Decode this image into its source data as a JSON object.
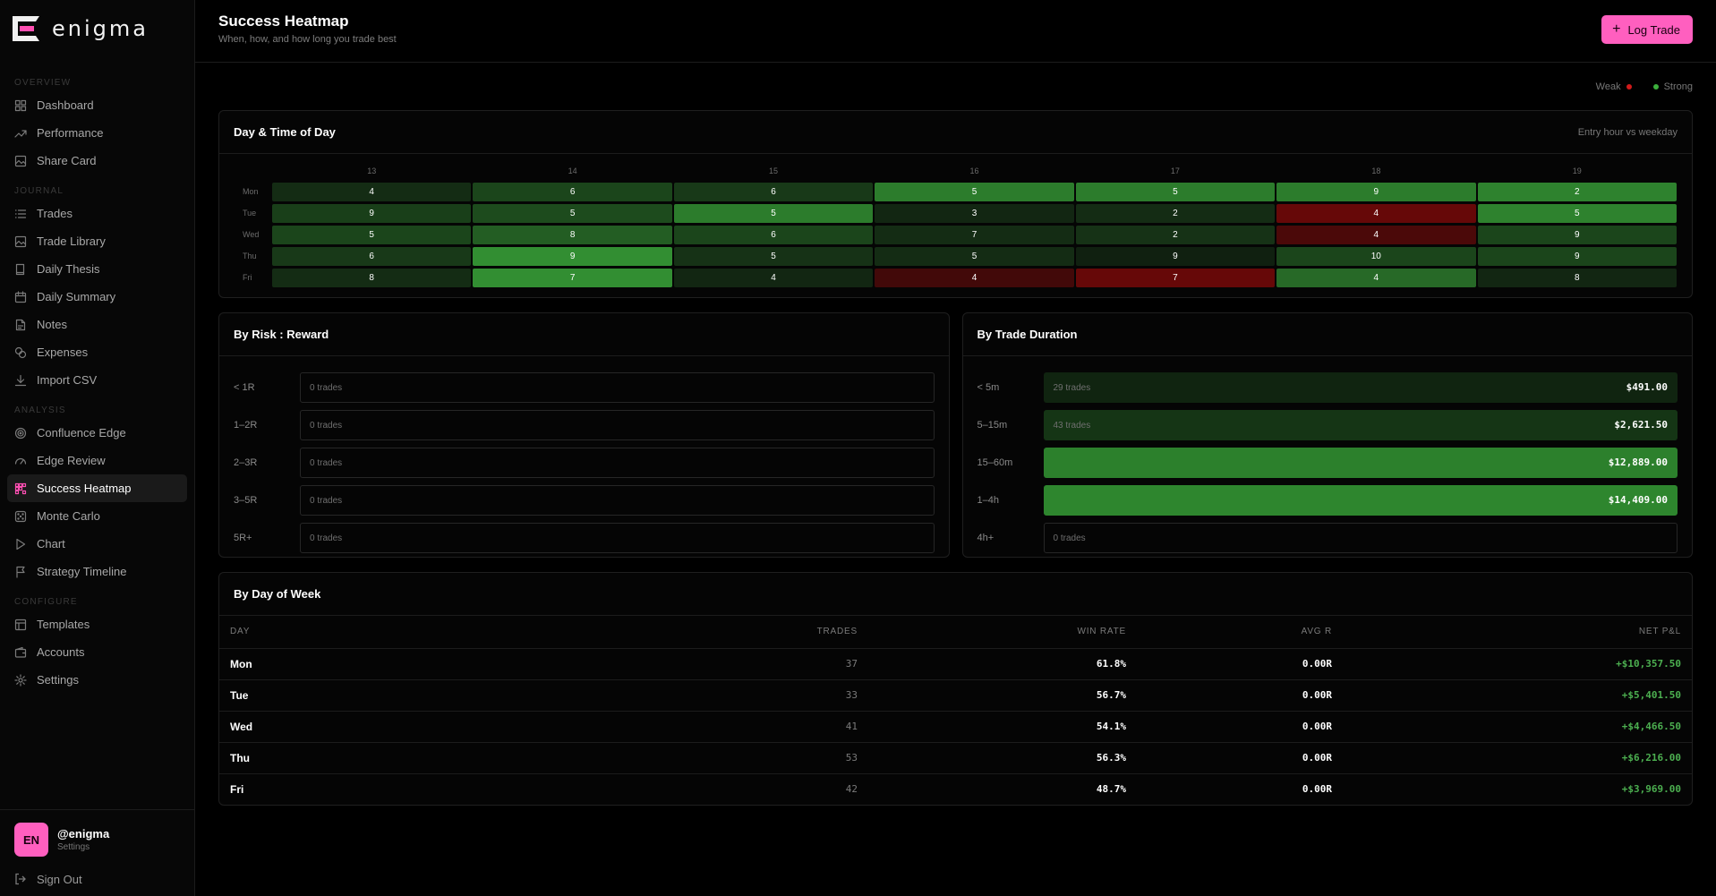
{
  "app": {
    "name": "enigma"
  },
  "sidebar": {
    "sections": [
      {
        "title": "OVERVIEW",
        "items": [
          {
            "label": "Dashboard",
            "icon": "grid-icon"
          },
          {
            "label": "Performance",
            "icon": "trend-up-icon"
          },
          {
            "label": "Share Card",
            "icon": "image-icon"
          }
        ]
      },
      {
        "title": "JOURNAL",
        "items": [
          {
            "label": "Trades",
            "icon": "list-icon"
          },
          {
            "label": "Trade Library",
            "icon": "image-icon"
          },
          {
            "label": "Daily Thesis",
            "icon": "book-icon"
          },
          {
            "label": "Daily Summary",
            "icon": "calendar-icon"
          },
          {
            "label": "Notes",
            "icon": "note-icon"
          },
          {
            "label": "Expenses",
            "icon": "coins-icon"
          },
          {
            "label": "Import CSV",
            "icon": "download-icon"
          }
        ]
      },
      {
        "title": "ANALYSIS",
        "items": [
          {
            "label": "Confluence Edge",
            "icon": "target-icon"
          },
          {
            "label": "Edge Review",
            "icon": "gauge-icon"
          },
          {
            "label": "Success Heatmap",
            "icon": "heatmap-icon",
            "active": true
          },
          {
            "label": "Monte Carlo",
            "icon": "dice-icon"
          },
          {
            "label": "Chart",
            "icon": "play-icon"
          },
          {
            "label": "Strategy Timeline",
            "icon": "flag-icon"
          }
        ]
      },
      {
        "title": "CONFIGURE",
        "items": [
          {
            "label": "Templates",
            "icon": "layout-icon"
          },
          {
            "label": "Accounts",
            "icon": "wallet-icon"
          },
          {
            "label": "Settings",
            "icon": "gear-icon"
          }
        ]
      }
    ]
  },
  "user": {
    "initials": "EN",
    "name": "@enigma",
    "sub": "Settings",
    "signout": "Sign Out"
  },
  "header": {
    "title": "Success Heatmap",
    "subtitle": "When, how, and how long you trade best",
    "log_label": "Log Trade"
  },
  "legend": {
    "weak": "Weak",
    "strong": "Strong",
    "weak_color": "#d11a1a",
    "strong_color": "#3cae3c"
  },
  "heatmap": {
    "title": "Day & Time of Day",
    "hint": "Entry hour vs weekday",
    "hours": [
      "13",
      "14",
      "15",
      "16",
      "17",
      "18",
      "19"
    ],
    "rows": [
      {
        "day": "Mon",
        "cells": [
          {
            "n": 4,
            "s": 0.15
          },
          {
            "n": 6,
            "s": 0.35
          },
          {
            "n": 6,
            "s": 0.25
          },
          {
            "n": 5,
            "s": 0.8
          },
          {
            "n": 5,
            "s": 0.8
          },
          {
            "n": 9,
            "s": 0.8
          },
          {
            "n": 2,
            "s": 0.85
          }
        ]
      },
      {
        "day": "Tue",
        "cells": [
          {
            "n": 9,
            "s": 0.3
          },
          {
            "n": 5,
            "s": 0.4
          },
          {
            "n": 5,
            "s": 0.8
          },
          {
            "n": 3,
            "s": 0.1
          },
          {
            "n": 2,
            "s": 0.15
          },
          {
            "n": 4,
            "s": -0.8
          },
          {
            "n": 5,
            "s": 0.85
          }
        ]
      },
      {
        "day": "Wed",
        "cells": [
          {
            "n": 5,
            "s": 0.35
          },
          {
            "n": 8,
            "s": 0.55
          },
          {
            "n": 6,
            "s": 0.35
          },
          {
            "n": 7,
            "s": 0.15
          },
          {
            "n": 2,
            "s": 0.2
          },
          {
            "n": 4,
            "s": -0.5
          },
          {
            "n": 9,
            "s": 0.35
          }
        ]
      },
      {
        "day": "Thu",
        "cells": [
          {
            "n": 6,
            "s": 0.25
          },
          {
            "n": 9,
            "s": 0.95
          },
          {
            "n": 5,
            "s": 0.2
          },
          {
            "n": 5,
            "s": 0.15
          },
          {
            "n": 9,
            "s": 0.05
          },
          {
            "n": 10,
            "s": 0.35
          },
          {
            "n": 9,
            "s": 0.35
          }
        ]
      },
      {
        "day": "Fri",
        "cells": [
          {
            "n": 8,
            "s": 0.15
          },
          {
            "n": 7,
            "s": 0.95
          },
          {
            "n": 4,
            "s": 0.1
          },
          {
            "n": 4,
            "s": -0.4
          },
          {
            "n": 7,
            "s": -0.8
          },
          {
            "n": 4,
            "s": 0.65
          },
          {
            "n": 8,
            "s": 0.1
          }
        ]
      }
    ]
  },
  "risk_reward": {
    "title": "By Risk : Reward",
    "rows": [
      {
        "label": "< 1R",
        "trades": "0 trades",
        "value": "",
        "fill": 0
      },
      {
        "label": "1–2R",
        "trades": "0 trades",
        "value": "",
        "fill": 0
      },
      {
        "label": "2–3R",
        "trades": "0 trades",
        "value": "",
        "fill": 0
      },
      {
        "label": "3–5R",
        "trades": "0 trades",
        "value": "",
        "fill": 0
      },
      {
        "label": "5R+",
        "trades": "0 trades",
        "value": "",
        "fill": 0
      }
    ]
  },
  "duration": {
    "title": "By Trade Duration",
    "rows": [
      {
        "label": "< 5m",
        "trades": "29 trades",
        "value": "$491.00",
        "fill": 0.1
      },
      {
        "label": "5–15m",
        "trades": "43 trades",
        "value": "$2,621.50",
        "fill": 0.25
      },
      {
        "label": "15–60m",
        "trades": "",
        "value": "$12,889.00",
        "fill": 0.9
      },
      {
        "label": "1–4h",
        "trades": "",
        "value": "$14,409.00",
        "fill": 0.95
      },
      {
        "label": "4h+",
        "trades": "0 trades",
        "value": "",
        "fill": 0
      }
    ]
  },
  "weekday": {
    "title": "By Day of Week",
    "columns": [
      "DAY",
      "TRADES",
      "WIN RATE",
      "AVG R",
      "NET P&L"
    ],
    "rows": [
      {
        "day": "Mon",
        "trades": "37",
        "win": "61.8%",
        "avg": "0.00R",
        "pnl": "+$10,357.50"
      },
      {
        "day": "Tue",
        "trades": "33",
        "win": "56.7%",
        "avg": "0.00R",
        "pnl": "+$5,401.50"
      },
      {
        "day": "Wed",
        "trades": "41",
        "win": "54.1%",
        "avg": "0.00R",
        "pnl": "+$4,466.50"
      },
      {
        "day": "Thu",
        "trades": "53",
        "win": "56.3%",
        "avg": "0.00R",
        "pnl": "+$6,216.00"
      },
      {
        "day": "Fri",
        "trades": "42",
        "win": "48.7%",
        "avg": "0.00R",
        "pnl": "+$3,969.00"
      }
    ]
  }
}
